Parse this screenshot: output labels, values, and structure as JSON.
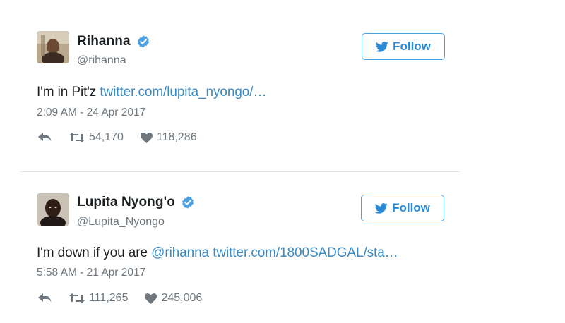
{
  "tweets": [
    {
      "name": "Rihanna",
      "handle": "@rihanna",
      "follow_label": "Follow",
      "text_prefix": "I'm in Pit'z ",
      "mention": "",
      "link": "twitter.com/lupita_nyongo/…",
      "timestamp": "2:09 AM - 24 Apr 2017",
      "retweets": "54,170",
      "likes": "118,286"
    },
    {
      "name": "Lupita Nyong'o",
      "handle": "@Lupita_Nyongo",
      "follow_label": "Follow",
      "text_prefix": "I'm down if you are ",
      "mention": "@rihanna",
      "link": " twitter.com/1800SADGAL/sta…",
      "timestamp": "5:58 AM - 21 Apr 2017",
      "retweets": "111,265",
      "likes": "245,006"
    }
  ],
  "colors": {
    "accent": "#2a8ad8",
    "link": "#3a8bc4",
    "muted": "#6e777e",
    "verified": "#4ba2e4"
  },
  "icons": [
    "verified-badge-icon",
    "twitter-bird-icon",
    "reply-icon",
    "retweet-icon",
    "heart-icon"
  ]
}
